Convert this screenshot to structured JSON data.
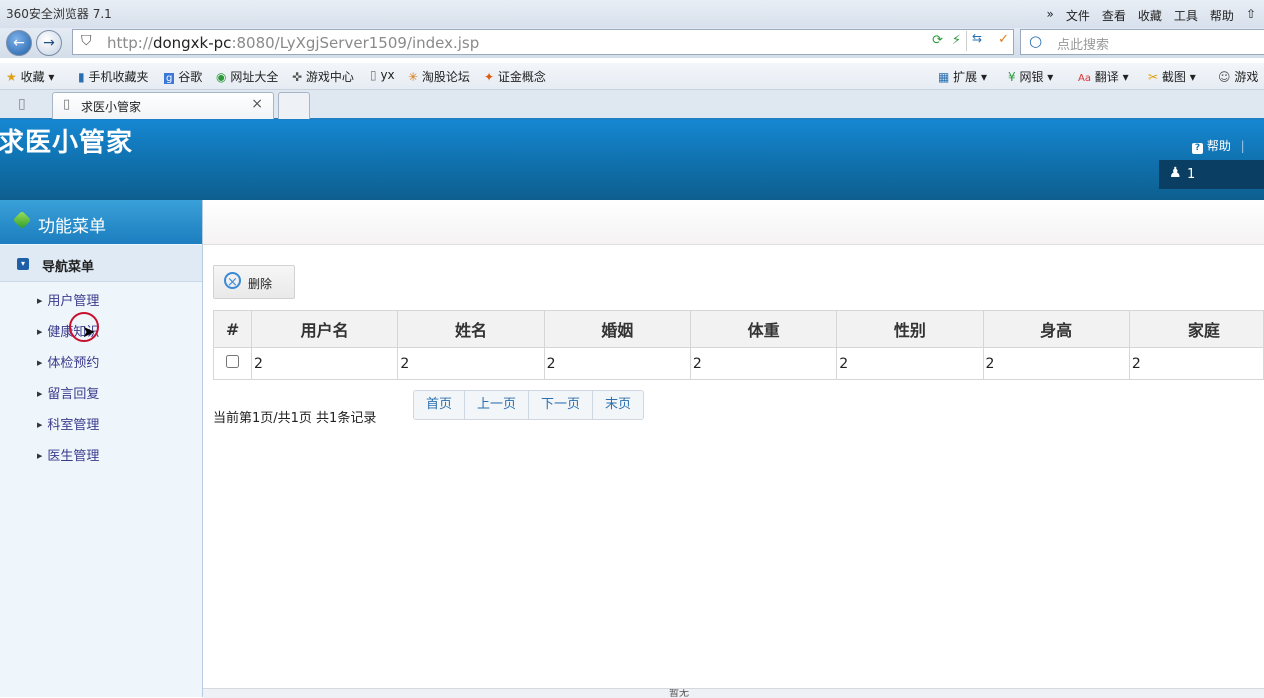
{
  "browser": {
    "window_title": "360安全浏览器 7.1",
    "menu_items": [
      "»",
      "文件",
      "查看",
      "收藏",
      "工具",
      "帮助"
    ],
    "url_gray_prefix": "http://",
    "url_host": "dongxk-pc",
    "url_rest": ":8080/LyXgjServer1509/index.jsp",
    "search_placeholder": "点此搜索",
    "favorites_left": [
      "收藏",
      "手机收藏夹",
      "谷歌",
      "网址大全",
      "游戏中心",
      "yx",
      "淘股论坛",
      "证金概念"
    ],
    "favorites_right": [
      "扩展",
      "网银",
      "翻译",
      "截图",
      "游戏"
    ],
    "tab_title": "求医小管家",
    "tab_close": "×"
  },
  "header": {
    "app_title": "求医小管家",
    "help_label": "帮助",
    "user_name": "1"
  },
  "sidebar": {
    "title": "功能菜单",
    "nav_header": "导航菜单",
    "items": [
      "用户管理",
      "健康知识",
      "体检预约",
      "留言回复",
      "科室管理",
      "医生管理"
    ]
  },
  "toolbar": {
    "delete_label": "删除"
  },
  "table": {
    "columns": [
      "#",
      "用户名",
      "姓名",
      "婚姻",
      "体重",
      "性别",
      "身高",
      "家庭"
    ],
    "rows": [
      [
        "2",
        "2",
        "2",
        "2",
        "2",
        "2",
        "2"
      ]
    ]
  },
  "pagination": {
    "info": "当前第1页/共1页  共1条记录",
    "buttons": [
      "首页",
      "上一页",
      "下一页",
      "末页"
    ]
  },
  "status": {
    "text": "暂无"
  }
}
